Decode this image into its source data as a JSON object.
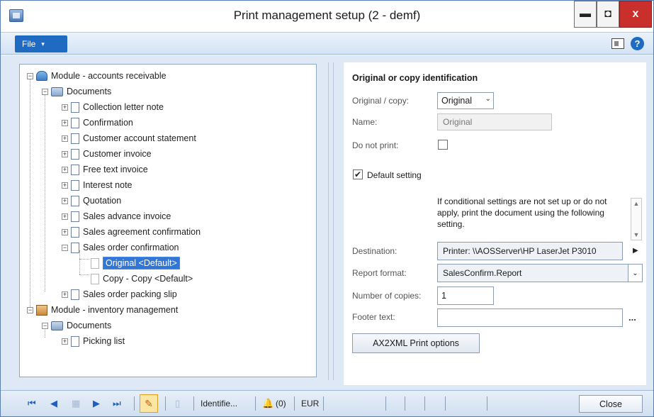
{
  "window": {
    "title": "Print management setup (2 - demf)",
    "controls": {
      "minimize": "▬",
      "maximize": "◘",
      "close": "x"
    }
  },
  "menubar": {
    "file_label": "File",
    "file_caret": "▾",
    "icons": [
      "window-icon",
      "help-icon"
    ],
    "help_glyph": "?"
  },
  "tree": {
    "expand_glyph": "+",
    "collapse_glyph": "−",
    "items": [
      {
        "label": "Module - accounts receivable",
        "level": 0,
        "expanded": true,
        "icon": "module-icon"
      },
      {
        "label": "Documents",
        "level": 1,
        "expanded": true,
        "icon": "documents-icon"
      },
      {
        "label": "Collection letter note",
        "level": 2,
        "expanded": false,
        "icon": "document-icon"
      },
      {
        "label": "Confirmation",
        "level": 2,
        "expanded": false,
        "icon": "document-icon"
      },
      {
        "label": "Customer account statement",
        "level": 2,
        "expanded": false,
        "icon": "document-icon"
      },
      {
        "label": "Customer invoice",
        "level": 2,
        "expanded": false,
        "icon": "document-icon"
      },
      {
        "label": "Free text invoice",
        "level": 2,
        "expanded": false,
        "icon": "document-icon"
      },
      {
        "label": "Interest note",
        "level": 2,
        "expanded": false,
        "icon": "document-icon"
      },
      {
        "label": "Quotation",
        "level": 2,
        "expanded": false,
        "icon": "document-icon"
      },
      {
        "label": "Sales advance invoice",
        "level": 2,
        "expanded": false,
        "icon": "document-icon"
      },
      {
        "label": "Sales agreement confirmation",
        "level": 2,
        "expanded": false,
        "icon": "document-icon"
      },
      {
        "label": "Sales order confirmation",
        "level": 2,
        "expanded": true,
        "icon": "document-icon"
      },
      {
        "label": "Original <Default>",
        "level": 3,
        "selected": true,
        "icon": "setting-icon"
      },
      {
        "label": "Copy - Copy <Default>",
        "level": 3,
        "icon": "setting-icon"
      },
      {
        "label": "Sales order packing slip",
        "level": 2,
        "expanded": false,
        "icon": "document-icon"
      },
      {
        "label": "Module - inventory management",
        "level": 0,
        "expanded": true,
        "icon": "module-icon"
      },
      {
        "label": "Documents",
        "level": 1,
        "expanded": true,
        "icon": "documents-icon"
      },
      {
        "label": "Picking list",
        "level": 2,
        "expanded": false,
        "icon": "document-icon"
      }
    ]
  },
  "form": {
    "section_title": "Original or copy identification",
    "original_copy_label": "Original / copy:",
    "original_copy_value": "Original",
    "dropdown_glyph": "⌄",
    "name_label": "Name:",
    "name_value": "Original",
    "do_not_print_label": "Do not print:",
    "do_not_print_checked": false,
    "default_setting_label": "Default setting",
    "default_setting_checked": true,
    "check_glyph": "✔",
    "info_text": "If conditional settings are not set up or do not apply, print the document using the following setting.",
    "scroll_up_glyph": "▲",
    "scroll_down_glyph": "▼",
    "destination_label": "Destination:",
    "destination_value": "Printer: \\\\AOSServer\\HP LaserJet P3010",
    "destination_arrow": "▶",
    "report_format_label": "Report format:",
    "report_format_value": "SalesConfirm.Report",
    "copies_label": "Number of copies:",
    "copies_value": "1",
    "footer_label": "Footer text:",
    "footer_value": "",
    "footer_lookup": "...",
    "ax_button_label": "AX2XML Print options"
  },
  "statusbar": {
    "nav": [
      "first-record-icon",
      "previous-record-icon",
      "grid-icon",
      "next-record-icon",
      "last-record-icon"
    ],
    "nav_glyphs": {
      "first": "⏮",
      "previous": "◀",
      "grid": "▦",
      "next": "▶",
      "last": "⏭"
    },
    "pencil_glyph": "✎",
    "doc_glyph": "▯",
    "identification": "Identifie...",
    "bell_glyph": "🔔",
    "alerts": "(0)",
    "currency": "EUR",
    "close_label": "Close"
  }
}
